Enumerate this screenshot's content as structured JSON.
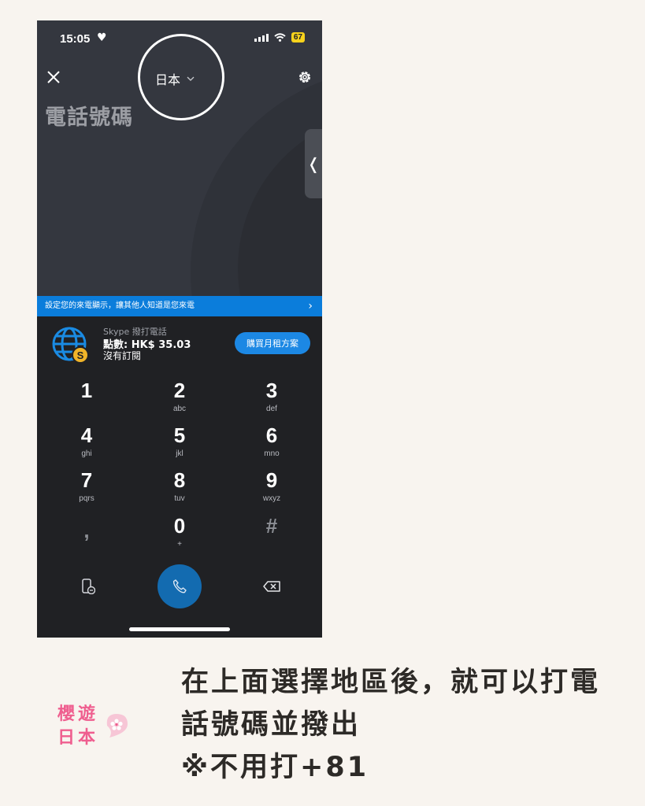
{
  "status_bar": {
    "time": "15:05",
    "heart": "♥",
    "battery": "67",
    "icons": [
      "signal-icon",
      "wifi-icon",
      "battery-icon"
    ]
  },
  "header": {
    "close_icon": "close-icon",
    "country": "日本",
    "dropdown_icon": "chevron-down-icon",
    "settings_icon": "gear-icon",
    "title": "電話號碼",
    "side_handle": "❬"
  },
  "banner": {
    "text": "設定您的來電顯示，讓其他人知道是您來電",
    "chevron": "›"
  },
  "credit": {
    "service": "Skype 撥打電話",
    "points": "點數: HK$ 35.03",
    "subscription": "沒有訂閱",
    "buy_button": "購買月租方案"
  },
  "keypad": {
    "keys": [
      {
        "digit": "1",
        "letters": ""
      },
      {
        "digit": "2",
        "letters": "abc"
      },
      {
        "digit": "3",
        "letters": "def"
      },
      {
        "digit": "4",
        "letters": "ghi"
      },
      {
        "digit": "5",
        "letters": "jkl"
      },
      {
        "digit": "6",
        "letters": "mno"
      },
      {
        "digit": "7",
        "letters": "pqrs"
      },
      {
        "digit": "8",
        "letters": "tuv"
      },
      {
        "digit": "9",
        "letters": "wxyz"
      },
      {
        "digit": ",",
        "letters": ""
      },
      {
        "digit": "0",
        "letters": "+"
      },
      {
        "digit": "#",
        "letters": ""
      }
    ]
  },
  "bottom_bar": {
    "left_icon": "phone-credit-icon",
    "call_icon": "phone-icon",
    "delete_icon": "backspace-icon"
  },
  "caption": {
    "line1": "在上面選擇地區後，就可以打電",
    "line2": "話號碼並撥出",
    "line3": "※不用打+81"
  },
  "logo": {
    "line1": "櫻遊",
    "line2": "日本"
  },
  "colors": {
    "accent": "#0b7ddb",
    "call_button": "#136bb0",
    "logo": "#ef5e8f",
    "battery": "#f7d21c"
  }
}
